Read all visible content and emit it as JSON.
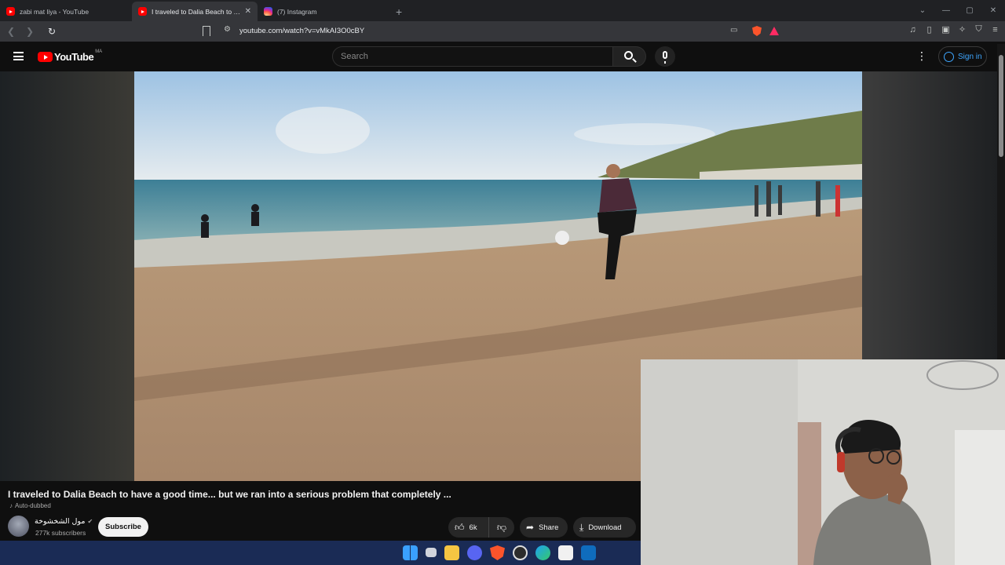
{
  "browser": {
    "tabs": [
      {
        "title": "zabi mat liya - YouTube",
        "favicon": "youtube-favicon",
        "active": false
      },
      {
        "title": "I traveled to Dalia Beach to have",
        "favicon": "youtube-favicon",
        "active": true
      },
      {
        "title": "(7) Instagram",
        "favicon": "instagram-favicon",
        "active": false
      }
    ],
    "url": "youtube.com/watch?v=vMkAI3O0cBY",
    "new_tab_label": "+",
    "close_label": "✕"
  },
  "youtube": {
    "logo_text": "YouTube",
    "country_code": "MA",
    "search_placeholder": "Search",
    "sign_in_label": "Sign in",
    "more_label": "⋮"
  },
  "video": {
    "title": "I traveled to Dalia Beach to have a good time... but we ran into a serious problem that completely ...",
    "auto_dubbed": "Auto-dubbed",
    "channel_name": "مول الشخشوخة",
    "subscribers": "277k subscribers",
    "subscribe_label": "Subscribe",
    "likes": "6k",
    "share_label": "Share",
    "download_label": "Download"
  },
  "colors": {
    "youtube_red": "#ff0000",
    "link_blue": "#3ea6ff",
    "background": "#0f0f0f",
    "taskbar": "#1a2b55"
  }
}
